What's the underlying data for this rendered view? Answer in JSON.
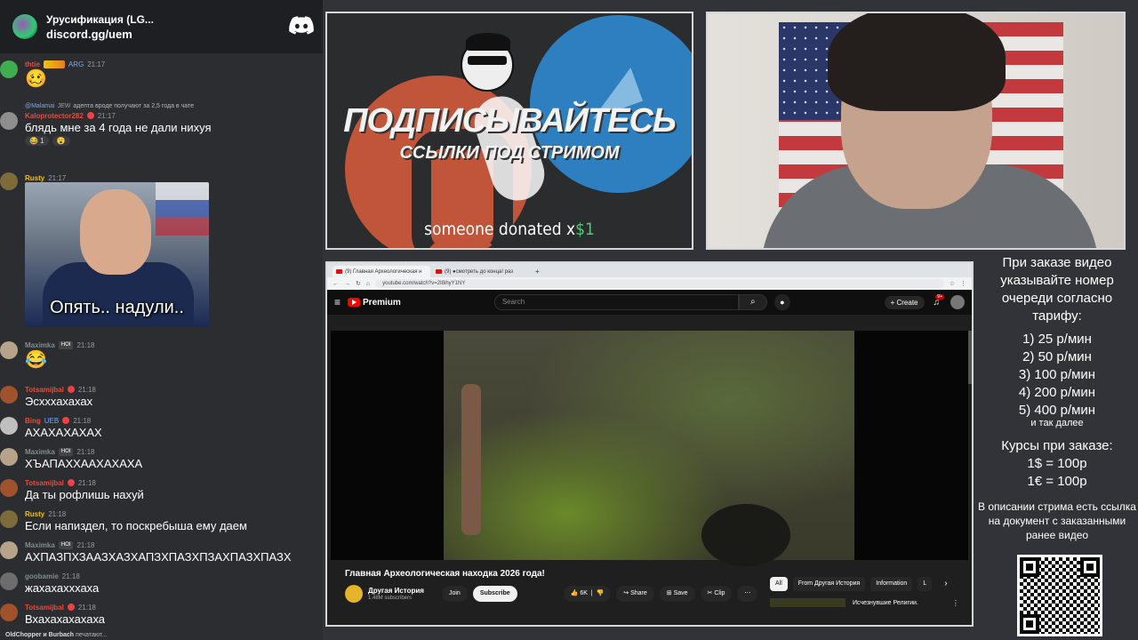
{
  "discord": {
    "server_name": "Урусификация (LG...",
    "invite": "discord.gg/uem",
    "messages": [
      {
        "user": "thtie",
        "badge": "ARG",
        "time": "21:17",
        "text": "",
        "emoji": "🥴"
      },
      {
        "reply_user": "@Malamai",
        "reply_badge": "JEW",
        "reply_text": "адепта вроде получают за 2,5 года в чате",
        "user": "Kaloprotector282",
        "time": "21:17",
        "text": "блядь мне за 4 года не дали нихуя",
        "reactions": [
          "😂 1",
          "😮"
        ]
      },
      {
        "user": "Rusty",
        "time": "21:17",
        "text": "",
        "image_caption": "Опять.. надули.."
      },
      {
        "user": "Maximka",
        "badge": "HOI",
        "time": "21:18",
        "text": "",
        "emoji": "😂"
      },
      {
        "user": "Totsamijbal",
        "time": "21:18",
        "text": "Эсхххахахах"
      },
      {
        "user": "Bing",
        "badge": "UEB",
        "time": "21:18",
        "text": "АХАХАХАХАХ"
      },
      {
        "user": "Maximka",
        "badge": "HOI",
        "time": "21:18",
        "text": "ХЪАПАХХААХАХАХА"
      },
      {
        "user": "Totsamijbal",
        "time": "21:18",
        "text": "Да ты рофлишь нахуй"
      },
      {
        "user": "Rusty",
        "time": "21:18",
        "text": "Если напиздел, то поскребыша ему даем"
      },
      {
        "user": "Maximka",
        "badge": "HOI",
        "time": "21:18",
        "text": "АХПАЗПХЗААЗХАЗХАПЗХПАЗХПЗАХПАЗХПАЗХ"
      },
      {
        "user": "goobamie",
        "time": "21:18",
        "text": "жахахахххаха"
      },
      {
        "user": "Totsamijbal",
        "time": "21:18",
        "text": "Вхахахахахаха"
      }
    ],
    "typing": {
      "names": "OldChopper и Burbach",
      "suffix": "печатают..."
    }
  },
  "promo": {
    "title": "ПОДПИСЫВАЙТЕСЬ",
    "subtitle": "ССЫЛКИ ПОД СТРИМОМ",
    "donation_prefix": "someone donated x",
    "donation_amount": "$1"
  },
  "browser": {
    "tabs": [
      "(9) Главная Археологическая н",
      "(9) ●смотреть до конца! раз"
    ],
    "url": "youtube.com/watch?v=2I8ihyY1NY",
    "yt": {
      "logo": "Premium",
      "search_placeholder": "Search",
      "create": "Create",
      "bell_count": "9+",
      "video_title": "Главная Археологическая находка 2026 года!",
      "channel_name": "Другая История",
      "subscribers": "1.48M subscribers",
      "join": "Join",
      "subscribe": "Subscribe",
      "likes": "6K",
      "share": "Share",
      "save": "Save",
      "clip": "Clip",
      "chips": [
        "All",
        "From Другая История",
        "Information",
        "L"
      ],
      "rec_title": "Исчезнувшие Религии."
    }
  },
  "info": {
    "heading": "При заказе видео указывайте номер очереди согласно тарифу:",
    "tariffs": [
      "1) 25 р/мин",
      "2) 50 р/мин",
      "3) 100 р/мин",
      "4) 200 р/мин",
      "5) 400 р/мин"
    ],
    "and_so_on": "и так далее",
    "courses_title": "Курсы при заказе:",
    "courses": [
      "1$ = 100р",
      "1€ = 100р"
    ],
    "description": "В описании стрима есть ссылка на документ с заказанными ранее видео"
  },
  "colors": {
    "discord_bg": "#2b2d31",
    "yt_red": "#ff0000",
    "donation_green": "#4ecb71"
  }
}
